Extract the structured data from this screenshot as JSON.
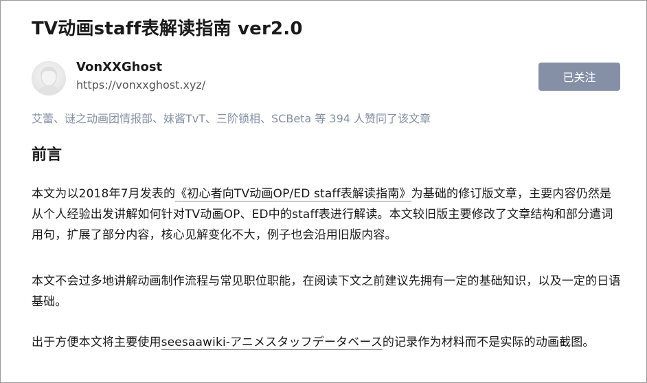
{
  "article": {
    "title": "TV动画staff表解读指南 ver2.0"
  },
  "author": {
    "name": "VonXXGhost",
    "url": "https://vonxxghost.xyz/",
    "avatar_icon": "avatar-image"
  },
  "follow_button": {
    "label": "已关注",
    "bg_color": "#8590a6"
  },
  "likes": {
    "text": "艾蕾、谜之动画团情报部、妹酱TvT、三阶锁相、SCBeta 等 394 人赞同了该文章",
    "color": "#8590a6"
  },
  "section": {
    "heading": "前言"
  },
  "paragraphs": {
    "p1_pre": "本文为以2018年7月发表的",
    "p1_link": "《初心者向TV动画OP/ED staff表解读指南》",
    "p1_post": "为基础的修订版文章，主要内容仍然是从个人经验出发讲解如何针对TV动画OP、ED中的staff表进行解读。本文较旧版主要修改了文章结构和部分遣词用句，扩展了部分内容，核心见解变化不大，例子也会沿用旧版内容。",
    "p2": "本文不会过多地讲解动画制作流程与常见职位职能，在阅读下文之前建议先拥有一定的基础知识，以及一定的日语基础。",
    "p3_pre": "出于方便本文将主要使用",
    "p3_link": "seesaawiki-アニメスタッフデータベース",
    "p3_post": "的记录作为材料而不是实际的动画截图。"
  }
}
